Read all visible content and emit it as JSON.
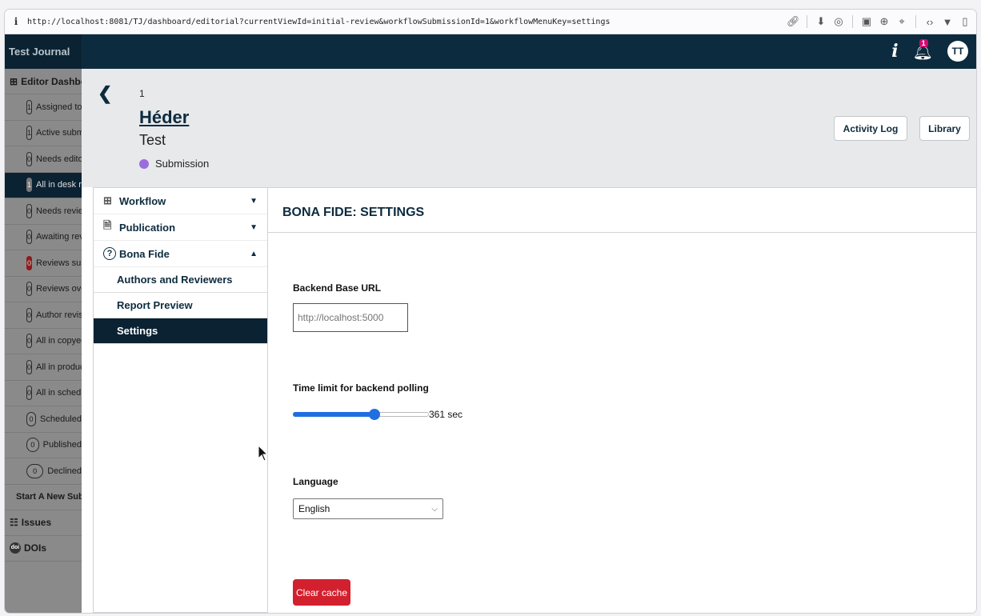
{
  "browser": {
    "url": "http://localhost:8081/TJ/dashboard/editorial?currentViewId=initial-review&workflowSubmissionId=1&workflowMenuKey=settings"
  },
  "topbar": {
    "journal_name": "Test Journal",
    "notification_count": "1",
    "avatar_initials": "TT"
  },
  "sidebar": {
    "section_title": "Editor Dashboard",
    "items": [
      {
        "count": "1",
        "label": "Assigned to me"
      },
      {
        "count": "1",
        "label": "Active submissions"
      },
      {
        "count": "0",
        "label": "Needs editor"
      },
      {
        "count": "1",
        "label": "All in desk review"
      },
      {
        "count": "0",
        "label": "Needs reviewers"
      },
      {
        "count": "0",
        "label": "Awaiting reviewers"
      },
      {
        "count": "0",
        "label": "Reviews submitted"
      },
      {
        "count": "0",
        "label": "Reviews overdue"
      },
      {
        "count": "0",
        "label": "Author revisions"
      },
      {
        "count": "0",
        "label": "All in copyediting"
      },
      {
        "count": "0",
        "label": "All in production"
      },
      {
        "count": "0",
        "label": "All in scheduled"
      },
      {
        "count": "0",
        "label": "Scheduled"
      },
      {
        "count": "0",
        "label": "Published"
      },
      {
        "count": "0",
        "label": "Declined"
      }
    ],
    "start_new": "Start A New Submission",
    "issues": "Issues",
    "dois": "DOIs"
  },
  "header": {
    "submission_id": "1",
    "author": "Héder",
    "title": "Test",
    "stage": "Submission",
    "activity_log": "Activity Log",
    "library": "Library"
  },
  "leftnav": {
    "workflow": "Workflow",
    "publication": "Publication",
    "bona_fide": "Bona Fide",
    "children": [
      "Authors and Reviewers",
      "Report Preview",
      "Settings"
    ]
  },
  "main": {
    "title": "BONA FIDE: SETTINGS",
    "backend_label": "Backend Base URL",
    "backend_placeholder": "http://localhost:5000",
    "polling_label": "Time limit for backend polling",
    "polling_value": "361 sec",
    "polling_fraction": 0.6,
    "language_label": "Language",
    "language_value": "English",
    "clear_cache": "Clear cache"
  },
  "colors": {
    "navy": "#0d2b3e",
    "stage_dot": "#9b6ddc",
    "slider": "#1f6fe0",
    "clear_button": "#d3202f"
  }
}
